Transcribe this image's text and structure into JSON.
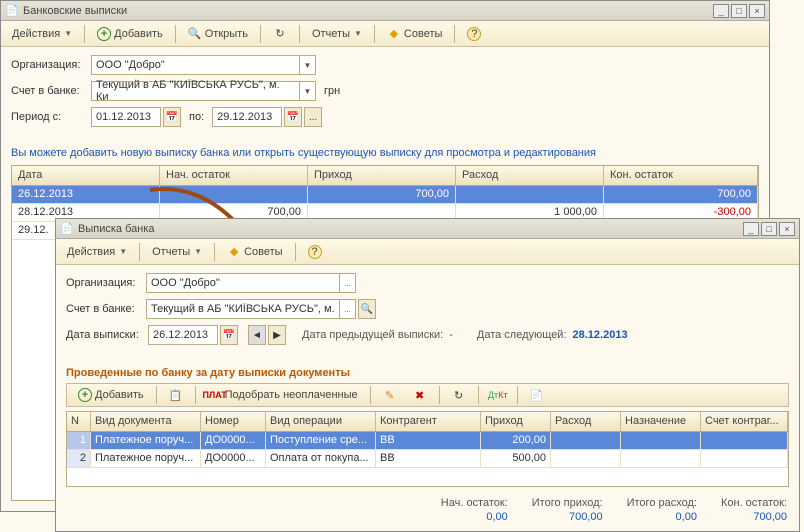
{
  "main": {
    "title": "Банковские выписки",
    "toolbar": {
      "actions": "Действия",
      "add": "Добавить",
      "open": "Открыть",
      "reports": "Отчеты",
      "tips": "Советы"
    },
    "form": {
      "org_label": "Организация:",
      "org_value": "ООО \"Добро\"",
      "account_label": "Счет в банке:",
      "account_value": "Текущий в АБ \"КИЇВСЬКА РУСЬ\", м. Ки",
      "currency": "грн",
      "period_label": "Период с:",
      "period_from": "01.12.2013",
      "period_to_lbl": "по:",
      "period_to": "29.12.2013"
    },
    "hint": "Вы можете добавить новую выписку банка или открыть существующую выписку для просмотра и редактирования",
    "grid": {
      "headers": [
        "Дата",
        "Нач. остаток",
        "Приход",
        "Расход",
        "Кон. остаток"
      ],
      "rows": [
        {
          "date": "26.12.2013",
          "open": "",
          "in": "700,00",
          "out": "",
          "close": "700,00",
          "selected": true
        },
        {
          "date": "28.12.2013",
          "open": "700,00",
          "in": "",
          "out": "1 000,00",
          "close": "-300,00",
          "selected": false
        },
        {
          "date": "29.12.",
          "open": "",
          "in": "",
          "out": "",
          "close": "",
          "selected": false
        }
      ]
    }
  },
  "sub": {
    "title": "Выписка банка",
    "toolbar": {
      "actions": "Действия",
      "reports": "Отчеты",
      "tips": "Советы"
    },
    "form": {
      "org_label": "Организация:",
      "org_value": "ООО \"Добро\"",
      "account_label": "Счет в банке:",
      "account_value": "Текущий в АБ \"КИЇВСЬКА РУСЬ\", м.",
      "date_label": "Дата выписки:",
      "date_value": "26.12.2013",
      "prev_label": "Дата предыдущей выписки:",
      "prev_value": "-",
      "next_label": "Дата следующей:",
      "next_value": "28.12.2013"
    },
    "section": "Проведенные по банку за дату выписки документы",
    "sub_toolbar": {
      "add": "Добавить",
      "pick": "Подобрать неоплаченные"
    },
    "grid": {
      "headers": [
        "N",
        "Вид документа",
        "Номер",
        "Вид операции",
        "Контрагент",
        "Приход",
        "Расход",
        "Назначение ...",
        "Счет контраг..."
      ],
      "rows": [
        {
          "n": "1",
          "doc": "Платежное поруч...",
          "num": "ДО0000...",
          "op": "Поступление сре...",
          "ctr": "ВВ",
          "in": "200,00",
          "out": "",
          "purp": "",
          "acc": "",
          "selected": true
        },
        {
          "n": "2",
          "doc": "Платежное поруч...",
          "num": "ДО0000...",
          "op": "Оплата от покупа...",
          "ctr": "ВВ",
          "in": "500,00",
          "out": "",
          "purp": "",
          "acc": "",
          "selected": false
        }
      ]
    },
    "totals": {
      "open_lbl": "Нач. остаток:",
      "open_val": "0,00",
      "in_lbl": "Итого приход:",
      "in_val": "700,00",
      "out_lbl": "Итого расход:",
      "out_val": "0,00",
      "close_lbl": "Кон. остаток:",
      "close_val": "700,00"
    }
  }
}
